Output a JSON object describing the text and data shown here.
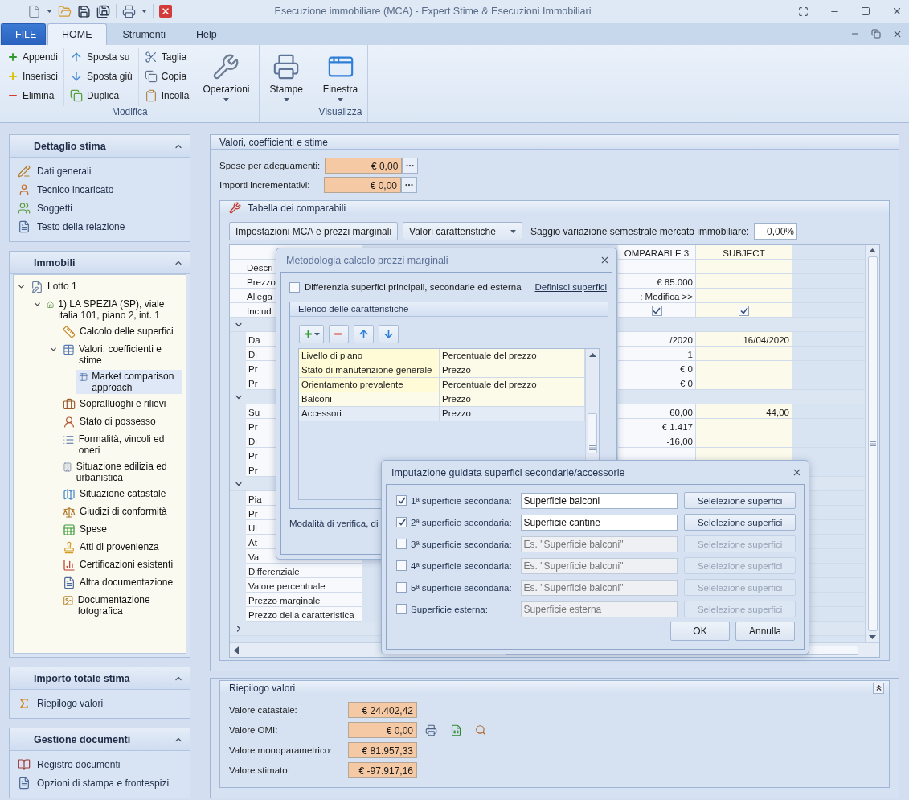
{
  "window": {
    "title": "Esecuzione immobiliare (MCA) - Expert Stime & Esecuzioni Immobiliari"
  },
  "ribbon": {
    "tabs": [
      {
        "label": "FILE",
        "kind": "file",
        "selected": false
      },
      {
        "label": "HOME",
        "kind": "tab",
        "selected": true
      },
      {
        "label": "Strumenti",
        "kind": "tab",
        "selected": false
      },
      {
        "label": "Help",
        "kind": "tab",
        "selected": false
      }
    ],
    "groups": [
      {
        "label": "Modifica",
        "columns": [
          [
            {
              "label": "Appendi",
              "kind": "append"
            },
            {
              "label": "Inserisci",
              "kind": "insert"
            },
            {
              "label": "Elimina",
              "kind": "delete"
            }
          ],
          [
            {
              "label": "Sposta su",
              "kind": "up"
            },
            {
              "label": "Sposta giù",
              "kind": "down"
            },
            {
              "label": "Duplica",
              "kind": "duplicate"
            }
          ],
          [
            {
              "label": "Taglia",
              "kind": "cut"
            },
            {
              "label": "Copia",
              "kind": "copy"
            },
            {
              "label": "Incolla",
              "kind": "paste"
            }
          ]
        ],
        "large": [
          {
            "label": "Operazioni",
            "kind": "tools"
          }
        ]
      },
      {
        "large": [
          {
            "label": "Stampe",
            "kind": "print"
          }
        ]
      },
      {
        "label": "Visualizza",
        "large": [
          {
            "label": "Finestra",
            "kind": "window"
          }
        ]
      }
    ]
  },
  "sidebar": [
    {
      "title": "Dettaglio stima",
      "expanded": true,
      "items": [
        {
          "label": "Dati generali",
          "kind": "edit"
        },
        {
          "label": "Tecnico incaricato",
          "kind": "person"
        },
        {
          "label": "Soggetti",
          "kind": "people"
        },
        {
          "label": "Testo della relazione",
          "kind": "doc"
        }
      ]
    },
    {
      "title": "Immobili",
      "expanded": true,
      "tree": [
        {
          "label": "Lotto 1",
          "kind": "lot",
          "expanded": true,
          "selected": false,
          "children": [
            {
              "label": "1) LA SPEZIA (SP), viale italia 101, piano 2, int. 1",
              "kind": "property",
              "expanded": true,
              "selected": false,
              "children": [
                {
                  "label": "Calcolo delle superfici",
                  "kind": "calc",
                  "selected": false
                },
                {
                  "label": "Valori, coefficienti e stime",
                  "kind": "values",
                  "expanded": true,
                  "selected": false,
                  "children": [
                    {
                      "label": "Market comparison approach",
                      "kind": "market",
                      "selected": true
                    }
                  ]
                },
                {
                  "label": "Sopralluoghi e rilievi",
                  "kind": "survey",
                  "selected": false
                },
                {
                  "label": "Stato di possesso",
                  "kind": "possession",
                  "selected": false
                },
                {
                  "label": "Formalità, vincoli ed oneri",
                  "kind": "list",
                  "selected": false
                },
                {
                  "label": "Situazione edilizia ed urbanistica",
                  "kind": "building",
                  "selected": false
                },
                {
                  "label": "Situazione catastale",
                  "kind": "cadastre",
                  "selected": false
                },
                {
                  "label": "Giudizi di conformità",
                  "kind": "scales",
                  "selected": false
                },
                {
                  "label": "Spese",
                  "kind": "expenses",
                  "selected": false
                },
                {
                  "label": "Atti di provenienza",
                  "kind": "stamp",
                  "selected": false
                },
                {
                  "label": "Certificazioni esistenti",
                  "kind": "cert",
                  "selected": false
                },
                {
                  "label": "Altra documentazione",
                  "kind": "doc",
                  "selected": false
                },
                {
                  "label": "Documentazione fotografica",
                  "kind": "photo",
                  "selected": false
                }
              ]
            }
          ]
        }
      ]
    },
    {
      "title": "Importo totale stima",
      "expanded": true,
      "items": [
        {
          "label": "Riepilogo valori",
          "kind": "sum"
        }
      ]
    },
    {
      "title": "Gestione documenti",
      "expanded": true,
      "items": [
        {
          "label": "Registro documenti",
          "kind": "register"
        },
        {
          "label": "Opzioni di stampa e frontespizi",
          "kind": "doc"
        }
      ]
    }
  ],
  "values_panel": {
    "title": "Valori, coefficienti e stime",
    "fields": [
      {
        "label": "Spese per adeguamenti:",
        "value": "€ 0,00"
      },
      {
        "label": "Importi incrementativi:",
        "value": "€ 0,00"
      }
    ],
    "comparables": {
      "title": "Tabella dei comparabili",
      "buttons": [
        {
          "label": "Impostazioni MCA e prezzi marginali",
          "kind": "button"
        },
        {
          "label": "Valori caratteristiche",
          "kind": "dropdown"
        }
      ],
      "rate": {
        "label": "Saggio variazione semestrale mercato immobiliare:",
        "value": "0,00%"
      },
      "table": {
        "columns": [
          {
            "label": "OMPARABLE 3"
          },
          {
            "label": "SUBJECT"
          }
        ],
        "rows": [
          {
            "kind": "field",
            "label": "Descri"
          },
          {
            "kind": "field",
            "label": "Prezzo",
            "comparable_3": "€ 85.000"
          },
          {
            "kind": "field",
            "label": "Allega",
            "comparable_3": ": Modifica >>"
          },
          {
            "kind": "check",
            "label": "Includ",
            "comparable_3_checked": true,
            "subject_checked": true
          },
          {
            "kind": "group",
            "expanded": true,
            "children": [
              {
                "label": "Da",
                "comparable_3": "/2020",
                "subject": "16/04/2020"
              },
              {
                "label": "Di",
                "comparable_3": "1"
              },
              {
                "label": "Pr",
                "comparable_3": "€ 0"
              },
              {
                "label": "Pr",
                "comparable_3": "€ 0"
              }
            ]
          },
          {
            "kind": "group",
            "expanded": true,
            "children": [
              {
                "label": "Su",
                "comparable_3": "60,00",
                "subject": "44,00"
              },
              {
                "label": "Pr",
                "comparable_3": "€ 1.417"
              },
              {
                "label": "Di",
                "comparable_3": "-16,00"
              },
              {
                "label": "Pr"
              },
              {
                "label": "Pr"
              }
            ]
          },
          {
            "kind": "group",
            "expanded": true,
            "children": [
              {
                "label": "Pia"
              },
              {
                "label": "Pr"
              },
              {
                "label": "Ul"
              },
              {
                "label": "At"
              },
              {
                "label": "Va"
              },
              {
                "label": "Differenziale"
              },
              {
                "label": "Valore percentuale"
              },
              {
                "label": "Prezzo marginale"
              },
              {
                "label": "Prezzo della caratteristica"
              }
            ]
          },
          {
            "kind": "group",
            "expanded": false
          }
        ]
      }
    }
  },
  "summary_panel": {
    "title": "Riepilogo valori",
    "expanded": true,
    "rows": [
      {
        "label": "Valore catastale:",
        "value": "€ 24.402,42",
        "actions": false
      },
      {
        "label": "Valore OMI:",
        "value": "€ 0,00",
        "actions": true
      },
      {
        "label": "Valore monoparametrico:",
        "value": "€ 81.957,33",
        "actions": false
      },
      {
        "label": "Valore stimato:",
        "value": "€ -97.917,16",
        "actions": false
      }
    ]
  },
  "marginal_prices_dialog": {
    "title": "Metodologia calcolo prezzi marginali",
    "split_surfaces": {
      "label": "Differenzia superfici principali, secondarie ed esterna",
      "checked": false
    },
    "link": "Definisci superfici",
    "group_title": "Elenco delle caratteristiche",
    "characteristics": [
      {
        "name": "Livello di piano",
        "method": "Percentuale del prezzo",
        "highlighted": true,
        "selected": false
      },
      {
        "name": "Stato di manutenzione generale",
        "method": "Prezzo",
        "highlighted": true,
        "selected": false
      },
      {
        "name": "Orientamento prevalente",
        "method": "Percentuale del prezzo",
        "highlighted": true,
        "selected": false
      },
      {
        "name": "Balconi",
        "method": "Prezzo",
        "highlighted": false,
        "selected": false
      },
      {
        "name": "Accessori",
        "method": "Prezzo",
        "highlighted": false,
        "selected": true
      }
    ],
    "footer_text": "Modalità di verifica, di"
  },
  "surfaces_dialog": {
    "title": "Imputazione guidata superfici secondarie/accessorie",
    "rows": [
      {
        "label": "1ª superficie secondaria:",
        "checked": true,
        "value": "Superficie balconi",
        "button": "Selelezione superfici"
      },
      {
        "label": "2ª superficie secondaria:",
        "checked": true,
        "value": "Superficie cantine",
        "button": "Selelezione superfici"
      },
      {
        "label": "3ª superficie secondaria:",
        "checked": false,
        "placeholder": "Es. \"Superficie balconi\"",
        "button": "Selelezione superfici"
      },
      {
        "label": "4ª superficie secondaria:",
        "checked": false,
        "placeholder": "Es. \"Superficie balconi\"",
        "button": "Selelezione superfici"
      },
      {
        "label": "5ª superficie secondaria:",
        "checked": false,
        "placeholder": "Es. \"Superficie balconi\"",
        "button": "Selelezione superfici"
      },
      {
        "label": "Superficie esterna:",
        "checked": false,
        "placeholder": "Superficie esterna",
        "button": "Selelezione superfici"
      }
    ],
    "buttons": [
      "OK",
      "Annulla"
    ]
  }
}
